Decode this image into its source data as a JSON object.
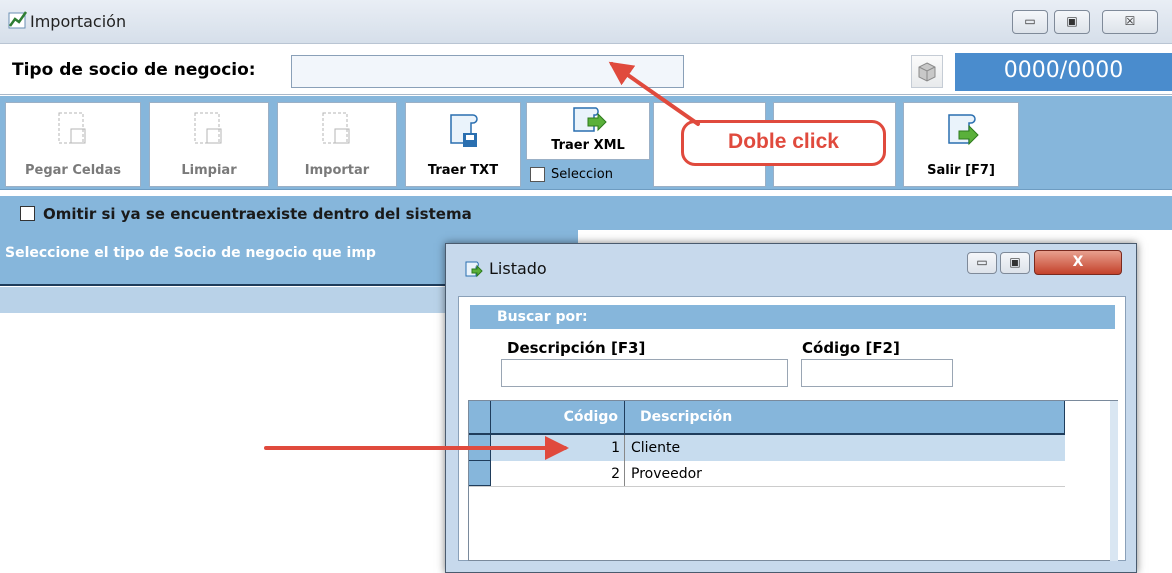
{
  "main_window": {
    "title": "Importación",
    "controls": {
      "minimize": "▭",
      "maximize": "▣",
      "close": "☒"
    }
  },
  "socio": {
    "label": "Tipo de socio de negocio:",
    "value": "",
    "counter": "0000/0000"
  },
  "toolbar": {
    "buttons": [
      {
        "label": "Pegar Celdas",
        "enabled": false
      },
      {
        "label": "Limpiar",
        "enabled": false
      },
      {
        "label": "Importar",
        "enabled": false
      },
      {
        "label": "Traer TXT",
        "enabled": true
      },
      {
        "label": "Traer XML",
        "enabled": true
      },
      {
        "label": "Salir [F7]",
        "enabled": true
      }
    ],
    "seleccion_label": "Seleccion"
  },
  "callout": {
    "text": "Doble click"
  },
  "options": {
    "omitir_label": "Omitir si ya se encuentraexiste dentro del sistema"
  },
  "left_panel": {
    "header": "Seleccione el tipo de Socio de negocio que imp"
  },
  "dialog": {
    "title": "Listado",
    "close_label": "X",
    "search_header": "Buscar por:",
    "descripcion_label": "Descripción [F3]",
    "codigo_label": "Código [F2]",
    "descripcion_value": "",
    "codigo_value": "",
    "grid": {
      "columns": [
        "Código",
        "Descripción"
      ],
      "rows": [
        {
          "codigo": "1",
          "descripcion": "Cliente"
        },
        {
          "codigo": "2",
          "descripcion": "Proveedor"
        }
      ]
    }
  },
  "colors": {
    "accent": "#86b6db",
    "counter_bg": "#4a8ccd",
    "callout": "#e04a3d"
  }
}
